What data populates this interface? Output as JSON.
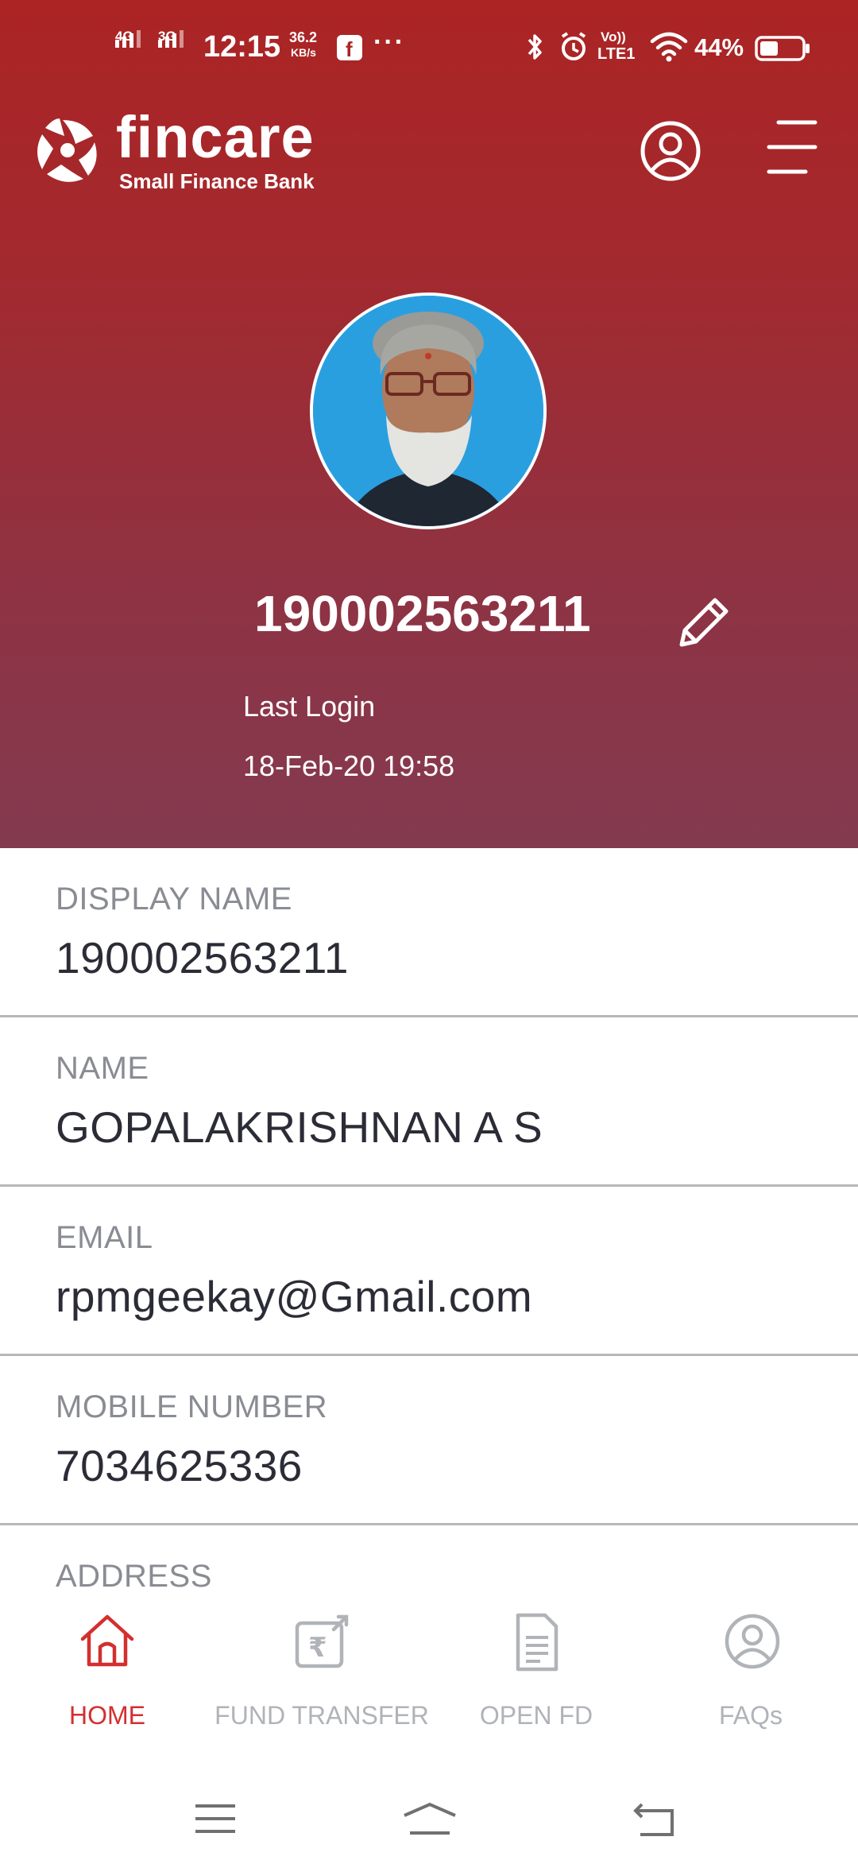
{
  "status_bar": {
    "net1": "4G",
    "net2": "3G",
    "time": "12:15",
    "speed_value": "36.2",
    "speed_unit": "KB/s",
    "more": "···",
    "volte": "Vo))",
    "lte": "LTE1",
    "battery": "44%"
  },
  "brand": {
    "name": "fincare",
    "subtitle": "Small Finance Bank"
  },
  "profile": {
    "account_number": "190002563211",
    "last_login_label": "Last Login",
    "last_login_value": "18-Feb-20 19:58"
  },
  "fields": [
    {
      "label": "DISPLAY NAME",
      "value": "190002563211"
    },
    {
      "label": "NAME",
      "value": "GOPALAKRISHNAN A S"
    },
    {
      "label": "EMAIL",
      "value": "rpmgeekay@Gmail.com"
    },
    {
      "label": "MOBILE NUMBER",
      "value": "7034625336"
    },
    {
      "label": "ADDRESS",
      "value": ""
    }
  ],
  "bottom_nav": {
    "home": "HOME",
    "fund_transfer": "FUND TRANSFER",
    "open_fd": "OPEN FD",
    "faqs": "FAQs"
  },
  "colors": {
    "header_top": "#ac2424",
    "header_bottom": "#843a4f",
    "active_nav": "#d32f2f",
    "inactive_nav": "#b0b3b8",
    "label_gray": "#8a8c93",
    "value_dark": "#2b2c36"
  }
}
